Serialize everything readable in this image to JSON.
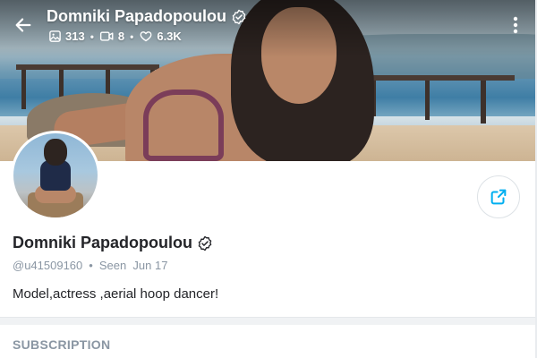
{
  "header": {
    "name": "Domniki Papadopoulou",
    "stats": {
      "photos": "313",
      "videos": "8",
      "likes": "6.3K"
    },
    "dot": "•"
  },
  "profile": {
    "name": "Domniki Papadopoulou",
    "username": "@u41509160",
    "separator": "•",
    "seen": "Seen  Jun 17",
    "bio": "Model,actress ,aerial hoop dancer!"
  },
  "section": {
    "subscription_label": "SUBSCRIPTION"
  },
  "icons": {
    "back": "arrow-left-icon",
    "verified": "verified-badge-icon",
    "photos": "image-icon",
    "videos": "video-icon",
    "likes": "heart-icon",
    "more": "more-vertical-icon",
    "share": "share-icon"
  },
  "colors": {
    "accent": "#00aff0",
    "muted": "#8a96a3",
    "text": "#242529"
  }
}
